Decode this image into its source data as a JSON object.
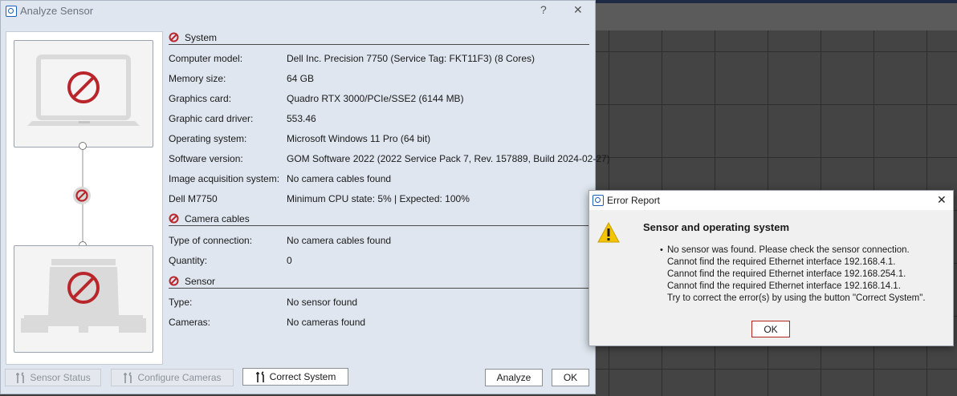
{
  "main_window": {
    "title": "Analyze Sensor",
    "help_glyph": "?",
    "close_glyph": "✕"
  },
  "sections": [
    {
      "title": "System",
      "icon": "prohibit-icon",
      "rows": [
        {
          "label": "Computer model:",
          "value": "Dell Inc. Precision 7750 (Service Tag: FKT11F3) (8 Cores)"
        },
        {
          "label": "Memory size:",
          "value": "64 GB"
        },
        {
          "label": "Graphics card:",
          "value": "Quadro RTX 3000/PCIe/SSE2 (6144 MB)"
        },
        {
          "label": "Graphic card driver:",
          "value": "553.46"
        },
        {
          "label": "Operating system:",
          "value": "Microsoft Windows 11 Pro (64 bit)"
        },
        {
          "label": "Software version:",
          "value": "GOM Software 2022 (2022 Service Pack 7, Rev. 157889, Build 2024-02-27)"
        },
        {
          "label": "Image acquisition system:",
          "value": "No camera cables found"
        },
        {
          "label": "Dell M7750",
          "value": "Minimum CPU state: 5% | Expected: 100%"
        }
      ]
    },
    {
      "title": "Camera cables",
      "icon": "prohibit-icon",
      "rows": [
        {
          "label": "Type of connection:",
          "value": "No camera cables found"
        },
        {
          "label": "Quantity:",
          "value": "0"
        }
      ]
    },
    {
      "title": "Sensor",
      "icon": "prohibit-icon",
      "rows": [
        {
          "label": "Type:",
          "value": "No sensor found"
        },
        {
          "label": "Cameras:",
          "value": "No cameras found"
        }
      ]
    }
  ],
  "buttons": {
    "sensor_status": "Sensor Status",
    "configure_cameras": "Configure Cameras",
    "correct_system": "Correct System",
    "analyze": "Analyze",
    "ok": "OK"
  },
  "error_dialog": {
    "title": "Error Report",
    "close_glyph": "✕",
    "heading": "Sensor and operating system",
    "bullet": "•",
    "lines": [
      "No sensor was found. Please check the sensor connection.",
      "Cannot find the required Ethernet interface 192.168.4.1.",
      "Cannot find the required Ethernet interface 192.168.254.1.",
      "Cannot find the required Ethernet interface 192.168.14.1.",
      "Try to correct the error(s) by using the button \"Correct System\"."
    ],
    "ok": "OK"
  },
  "colors": {
    "prohibit_red": "#b8262b",
    "warning_yellow": "#f2c500",
    "accent_blue": "#1f5fb8"
  }
}
